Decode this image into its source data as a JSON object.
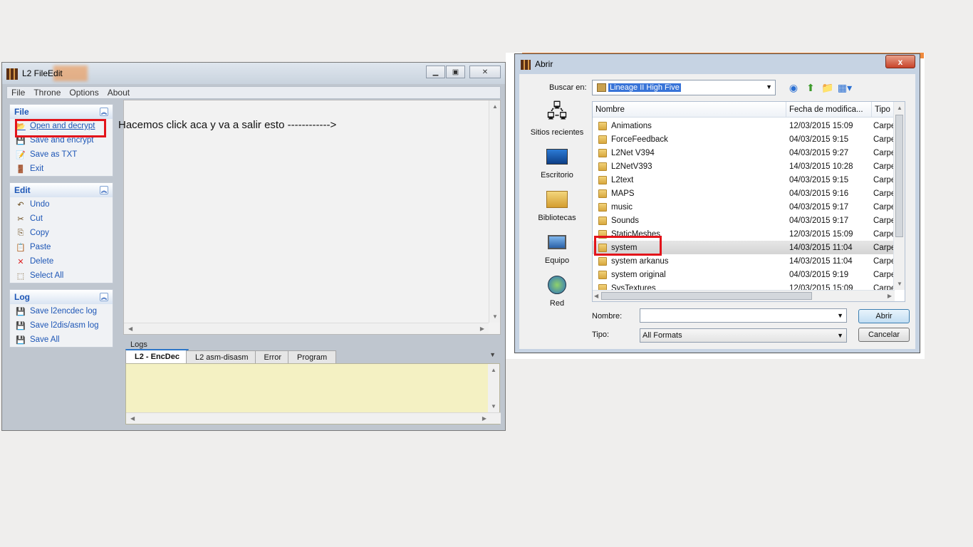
{
  "app": {
    "title": "L2 FileEdit",
    "menu": [
      "File",
      "Throne",
      "Options",
      "About"
    ],
    "groups": [
      {
        "title": "File",
        "items": [
          {
            "label": "Open and decrypt",
            "icon": "folder-open-icon"
          },
          {
            "label": "Save and encrypt",
            "icon": "floppy-icon"
          },
          {
            "label": "Save as TXT",
            "icon": "text-file-icon"
          },
          {
            "label": "Exit",
            "icon": "exit-door-icon"
          }
        ]
      },
      {
        "title": "Edit",
        "items": [
          {
            "label": "Undo",
            "icon": "undo-icon"
          },
          {
            "label": "Cut",
            "icon": "scissors-icon"
          },
          {
            "label": "Copy",
            "icon": "copy-icon"
          },
          {
            "label": "Paste",
            "icon": "paste-icon"
          },
          {
            "label": "Delete",
            "icon": "delete-x-icon"
          },
          {
            "label": "Select All",
            "icon": "select-all-icon"
          }
        ]
      },
      {
        "title": "Log",
        "items": [
          {
            "label": "Save l2encdec log",
            "icon": "floppy-icon"
          },
          {
            "label": "Save l2dis/asm log",
            "icon": "floppy-icon"
          },
          {
            "label": "Save All",
            "icon": "floppy-icon"
          }
        ]
      }
    ],
    "annotation": "Hacemos click aca y va a salir esto ------------>",
    "logs_label": "Logs",
    "log_tabs": [
      "L2 - EncDec",
      "L2 asm-disasm",
      "Error",
      "Program"
    ]
  },
  "dialog": {
    "title": "Abrir",
    "close_label": "x",
    "lookin_label": "Buscar en:",
    "lookin_value": "Lineage II High Five",
    "places": [
      {
        "label": "Sitios recientes",
        "icon": "recent-places-icon"
      },
      {
        "label": "Escritorio",
        "icon": "desktop-icon"
      },
      {
        "label": "Bibliotecas",
        "icon": "libraries-icon"
      },
      {
        "label": "Equipo",
        "icon": "computer-icon"
      },
      {
        "label": "Red",
        "icon": "network-icon"
      }
    ],
    "columns": [
      "Nombre",
      "Fecha de modifica...",
      "Tipo"
    ],
    "files": [
      {
        "name": "Animations",
        "date": "12/03/2015 15:09",
        "type": "Carpet"
      },
      {
        "name": "ForceFeedback",
        "date": "04/03/2015 9:15",
        "type": "Carpet"
      },
      {
        "name": "L2Net V394",
        "date": "04/03/2015 9:27",
        "type": "Carpet"
      },
      {
        "name": "L2NetV393",
        "date": "14/03/2015 10:28",
        "type": "Carpet"
      },
      {
        "name": "L2text",
        "date": "04/03/2015 9:15",
        "type": "Carpet"
      },
      {
        "name": "MAPS",
        "date": "04/03/2015 9:16",
        "type": "Carpet"
      },
      {
        "name": "music",
        "date": "04/03/2015 9:17",
        "type": "Carpet"
      },
      {
        "name": "Sounds",
        "date": "04/03/2015 9:17",
        "type": "Carpet"
      },
      {
        "name": "StaticMeshes",
        "date": "12/03/2015 15:09",
        "type": "Carpet"
      },
      {
        "name": "system",
        "date": "14/03/2015 11:04",
        "type": "Carpet"
      },
      {
        "name": "system arkanus",
        "date": "14/03/2015 11:04",
        "type": "Carpet"
      },
      {
        "name": "system original",
        "date": "04/03/2015 9:19",
        "type": "Carpet"
      },
      {
        "name": "SysTextures",
        "date": "12/03/2015 15:09",
        "type": "Carpet"
      }
    ],
    "selected_file": "system",
    "filename_label": "Nombre:",
    "filename_value": "",
    "type_label": "Tipo:",
    "type_value": "All Formats",
    "open_button": "Abrir",
    "cancel_button": "Cancelar"
  },
  "colors": {
    "highlight_box": "#e3141b",
    "task_link": "#1d56b6",
    "log_bg": "#f4f1c3"
  }
}
